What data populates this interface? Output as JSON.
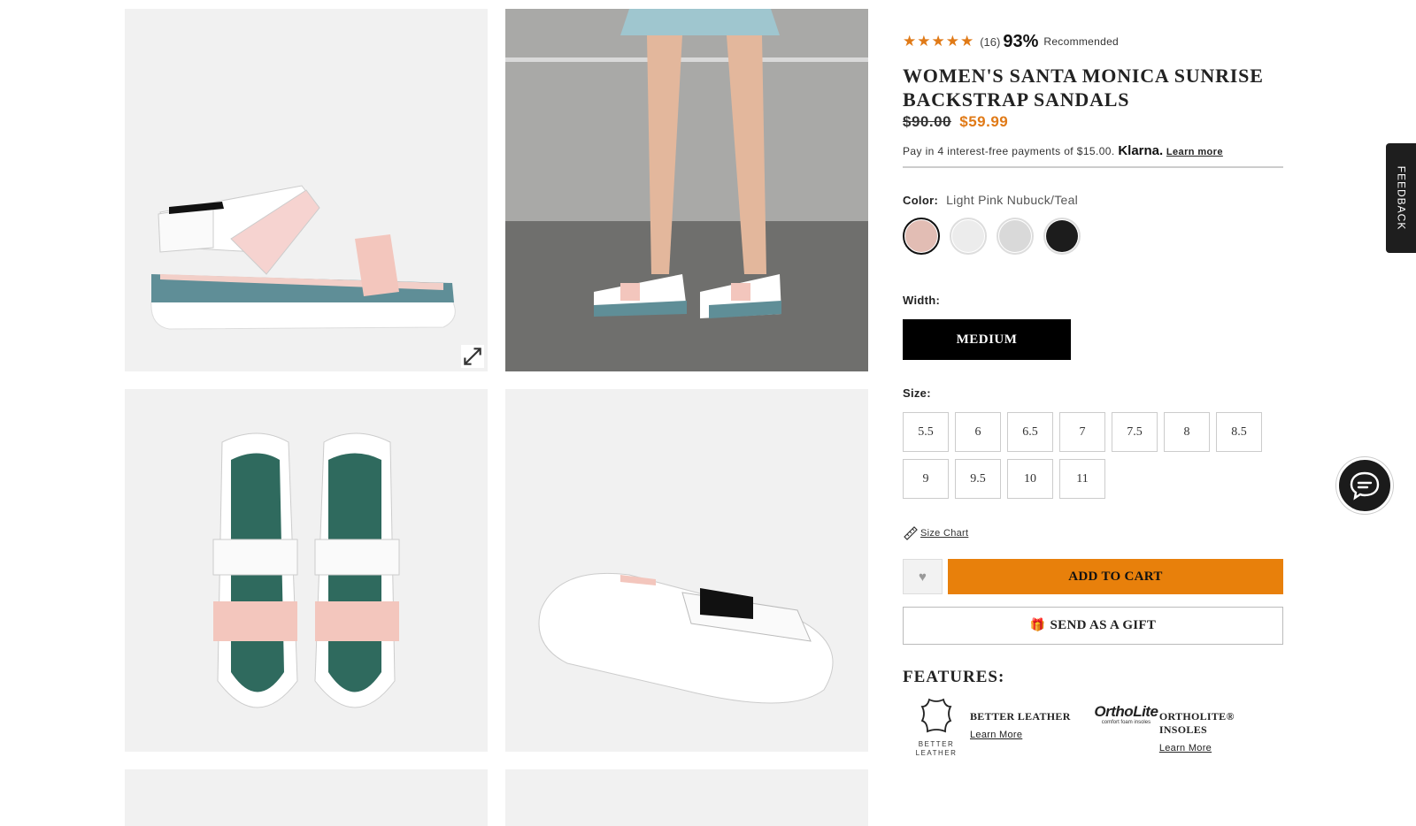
{
  "product": {
    "rating_stars": "★★★★★",
    "review_count": "(16)",
    "recommend_pct": "93%",
    "recommend_label": "Recommended",
    "title": "Women's Santa Monica Sunrise Backstrap Sandals",
    "price_old": "$90.00",
    "price_new": "$59.99",
    "klarna_text": "Pay in 4 interest-free payments of $15.00.",
    "klarna_brand": "Klarna.",
    "klarna_link": "Learn more",
    "accent_color": "#e8800b"
  },
  "color": {
    "label": "Color:",
    "value": "Light Pink Nubuck/Teal",
    "swatches": [
      {
        "name": "Light Pink Nubuck/Teal",
        "hex": "#e2bdb4",
        "selected": true
      },
      {
        "name": "White",
        "hex": "#ececec",
        "selected": false
      },
      {
        "name": "Light Grey",
        "hex": "#d9d9d9",
        "selected": false
      },
      {
        "name": "Black",
        "hex": "#1c1c1c",
        "selected": false
      }
    ]
  },
  "width": {
    "label": "Width:",
    "selected": "Medium"
  },
  "size": {
    "label": "Size:",
    "options": [
      "5.5",
      "6",
      "6.5",
      "7",
      "7.5",
      "8",
      "8.5",
      "9",
      "9.5",
      "10",
      "11"
    ],
    "chart_link": "Size Chart"
  },
  "actions": {
    "wishlist_icon": "heart-icon",
    "add_to_cart": "Add to Cart",
    "send_gift": "Send as a Gift"
  },
  "features": {
    "heading": "Features:",
    "items": [
      {
        "name": "Better Leather",
        "logo_caption": "BETTER LEATHER",
        "link": "Learn More",
        "icon": "leather-hide-icon"
      },
      {
        "name": "OrthoLite® Insoles",
        "logo_text": "OrthoLite",
        "logo_sub": "comfort foam insoles",
        "link": "Learn More",
        "icon": "ortholite-logo"
      }
    ]
  },
  "widgets": {
    "feedback_label": "FEEDBACK",
    "chat_icon": "chat-bubble-icon"
  }
}
